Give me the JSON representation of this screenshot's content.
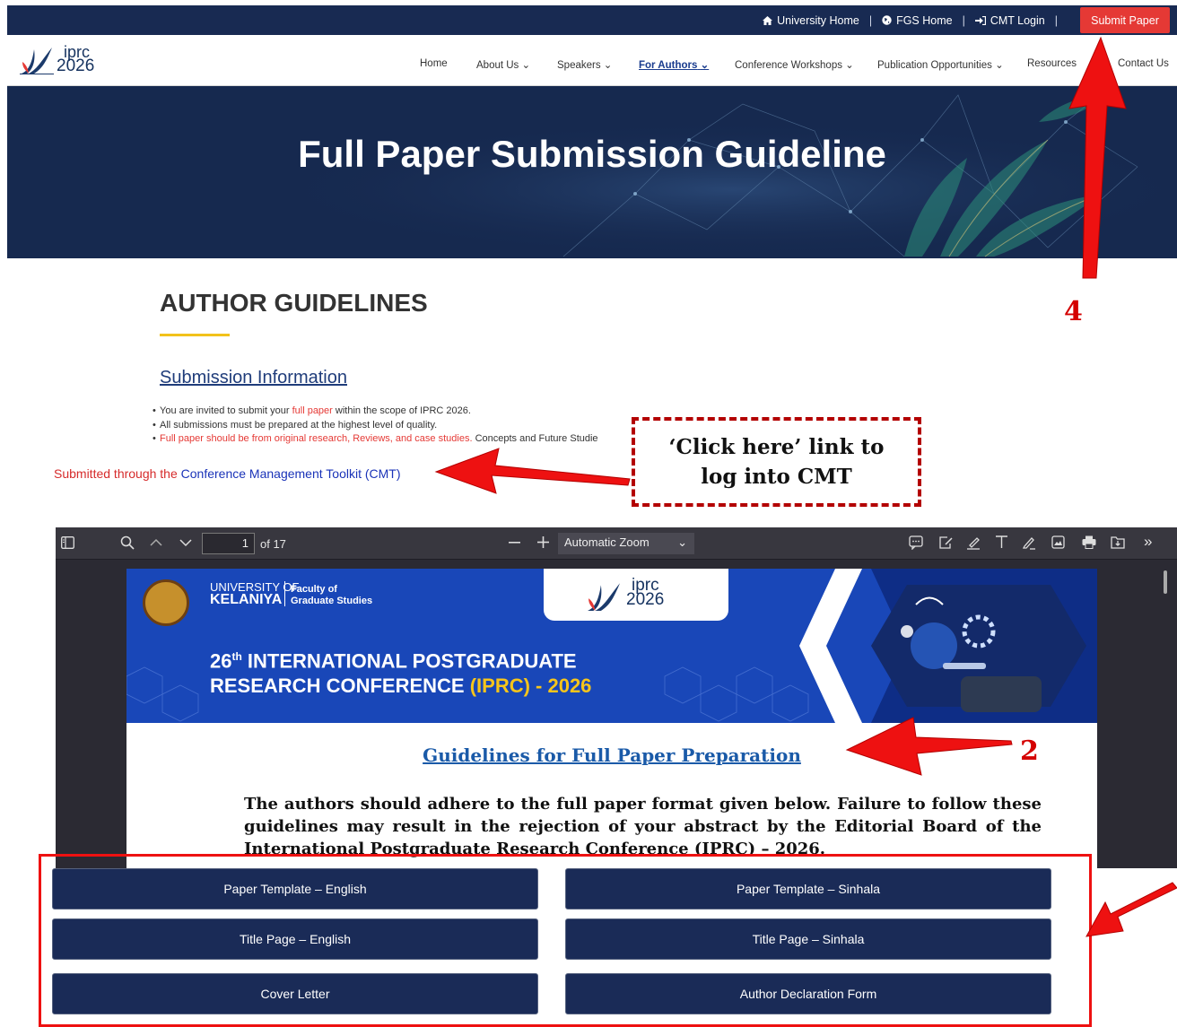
{
  "topbar": {
    "links": [
      {
        "icon": "home-icon",
        "label": "University Home"
      },
      {
        "icon": "globe-icon",
        "label": "FGS Home"
      },
      {
        "icon": "login-icon",
        "label": "CMT Login"
      }
    ],
    "submit_label": "Submit Paper"
  },
  "logo": {
    "word1": "iprc",
    "word2": "2026"
  },
  "nav": {
    "items": [
      "Home",
      "About Us",
      "Speakers",
      "For Authors",
      "Conference Workshops",
      "Publication Opportunities",
      "Resources",
      "Contact Us"
    ],
    "active": "For Authors"
  },
  "banner": {
    "title": "Full Paper Submission Guideline"
  },
  "content": {
    "heading": "AUTHOR GUIDELINES",
    "subheading": "Submission Information",
    "bullet1_pre": "You are invited to submit your ",
    "bullet1_link": "full paper",
    "bullet1_post": " within the scope of IPRC 2026.",
    "bullet2": "All submissions must be prepared at the highest level of quality.",
    "bullet3_red": "Full paper should be from original research, Reviews, and case studies.",
    "bullet3_post": " Concepts and Future Studie",
    "submitted_pre": "Submitted through the ",
    "submitted_link": "Conference Management Toolkit (CMT)"
  },
  "annotations": {
    "callout_line1": "‘Click here’ link to",
    "callout_line2": "log into CMT",
    "num_4": "4",
    "num_2": "2",
    "arrow_color": "#ee1111"
  },
  "pdf_viewer": {
    "page_current": "1",
    "page_total": "of 17",
    "zoom": "Automatic Zoom",
    "banner": {
      "uni_line1": "UNIVERSITY OF",
      "uni_line2": "KELANIYA",
      "faculty_line1": "Faculty of",
      "faculty_line2": "Graduate Studies",
      "logo_word1": "iprc",
      "logo_word2": "2026",
      "title_num": "26",
      "title_sup": "th",
      "title_rest": " INTERNATIONAL POSTGRADUATE",
      "title_line2": "RESEARCH CONFERENCE ",
      "title_line2_highlight": "(IPRC) - 2026"
    },
    "heading": "Guidelines for Full Paper Preparation",
    "body": "The authors should adhere to the full paper format given below. Failure to follow these guidelines may result in the rejection of your abstract by the Editorial Board of the International Postgraduate Research Conference (IPRC) – 2026."
  },
  "downloads": {
    "buttons": [
      "Paper Template – English",
      "Paper Template – Sinhala",
      "Title Page – English",
      "Title Page – Sinhala",
      "Cover Letter",
      "Author Declaration Form"
    ]
  },
  "colors": {
    "nav_dark": "#182a52",
    "submit_red": "#e53935",
    "button_navy": "#1a2b57",
    "accent_yellow": "#f2c21b"
  }
}
